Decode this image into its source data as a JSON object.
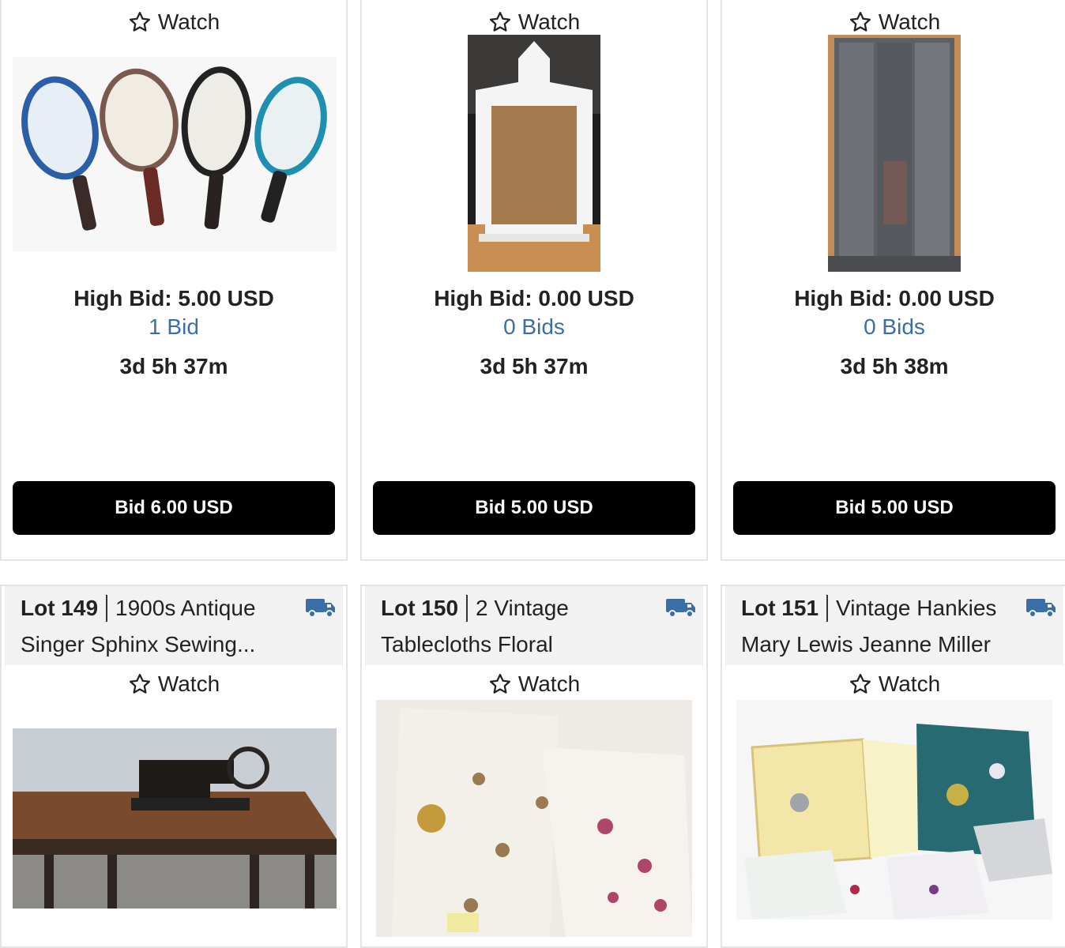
{
  "watch_label": "Watch",
  "cards_top": [
    {
      "high_bid": "High Bid: 5.00 USD",
      "bids": "1 Bid",
      "time_left": "3d 5h 37m",
      "bid_button": "Bid 6.00 USD"
    },
    {
      "high_bid": "High Bid: 0.00 USD",
      "bids": "0 Bids",
      "time_left": "3d 5h 37m",
      "bid_button": "Bid 5.00 USD"
    },
    {
      "high_bid": "High Bid: 0.00 USD",
      "bids": "0 Bids",
      "time_left": "3d 5h 38m",
      "bid_button": "Bid 5.00 USD"
    }
  ],
  "cards_bottom": [
    {
      "lot": "Lot 149",
      "title_line1": "1900s Antique",
      "title_line2": "Singer Sphinx Sewing..."
    },
    {
      "lot": "Lot 150",
      "title_line1": "2 Vintage",
      "title_line2": "Tablecloths Floral"
    },
    {
      "lot": "Lot 151",
      "title_line1": "Vintage Hankies",
      "title_line2": "Mary Lewis Jeanne Miller"
    }
  ],
  "colors": {
    "accent_blue": "#3b6ea5",
    "button_black": "#000000",
    "header_gray": "#f2f2f2"
  },
  "icons": {
    "watch": "star-outline-icon",
    "shipping": "truck-icon"
  }
}
